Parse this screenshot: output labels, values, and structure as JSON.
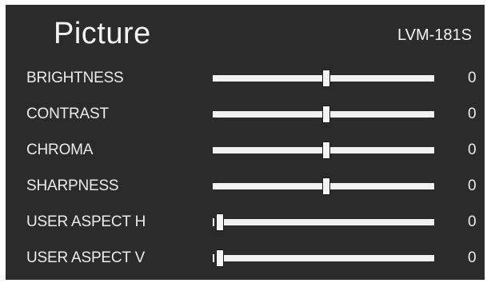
{
  "menu": {
    "title": "Picture",
    "model": "LVM-181S"
  },
  "settings": [
    {
      "label": "BRIGHTNESS",
      "value": "0",
      "level": 0.5
    },
    {
      "label": "CONTRAST",
      "value": "0",
      "level": 0.5
    },
    {
      "label": "CHROMA",
      "value": "0",
      "level": 0.5
    },
    {
      "label": "SHARPNESS",
      "value": "0",
      "level": 0.5
    },
    {
      "label": "USER ASPECT H",
      "value": "0",
      "level": 0.0
    },
    {
      "label": "USER ASPECT V",
      "value": "0",
      "level": 0.0
    }
  ],
  "colors": {
    "background": "#2b2b2b",
    "text": "#f2f2f2",
    "track": "#f2f2f2"
  }
}
